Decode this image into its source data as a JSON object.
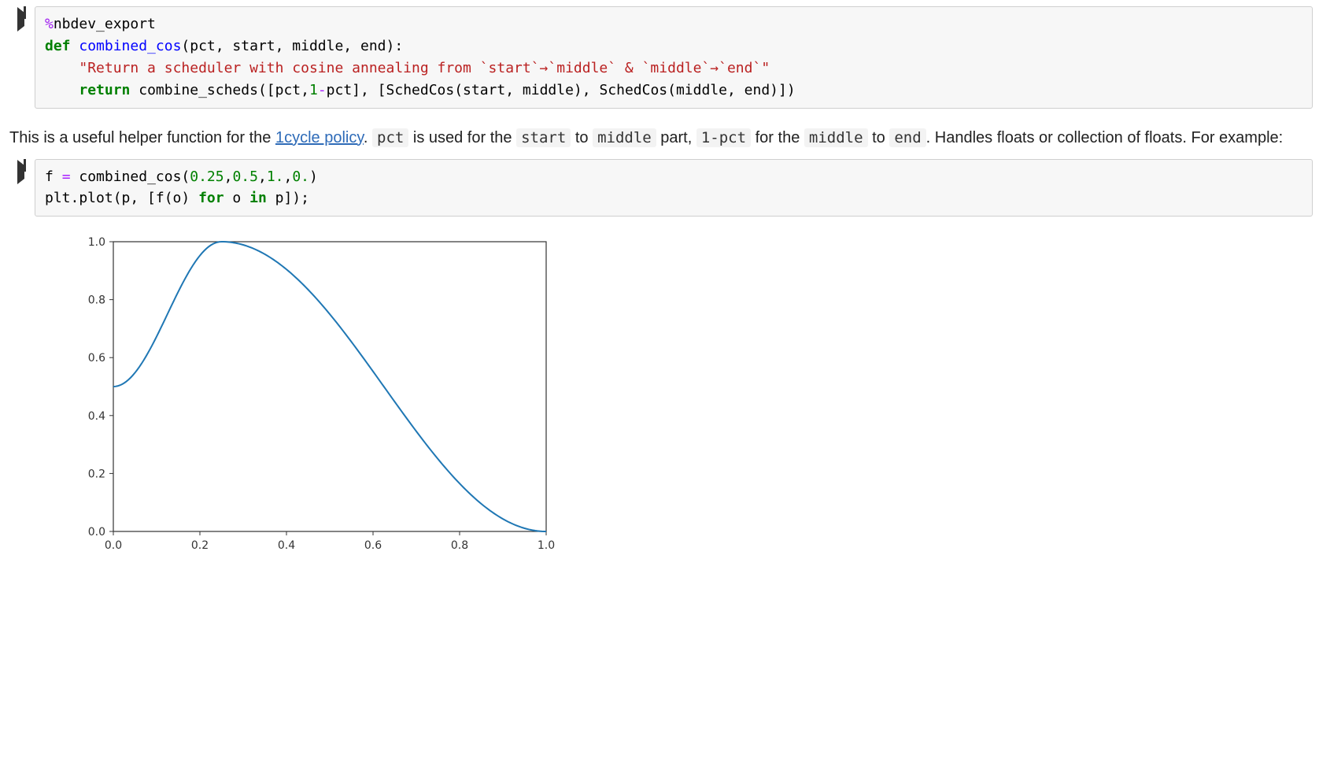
{
  "cell1": {
    "magic_pct": "%",
    "magic_name": "nbdev_export",
    "def_kw": "def",
    "fn_name": "combined_cos",
    "params": "(pct, start, middle, end):",
    "docstring": "\"Return a scheduler with cosine annealing from `start`→`middle` & `middle`→`end`\"",
    "return_kw": "return",
    "return_body_a": " combine_scheds([pct,",
    "one": "1",
    "minus": "-",
    "return_body_b": "pct], [SchedCos(start, middle), SchedCos(middle, end)])"
  },
  "md": {
    "pre_link": "This is a useful helper function for the ",
    "link_text": "1cycle policy",
    "post_link_1": ". ",
    "code_pct": "pct",
    "t2": " is used for the ",
    "code_start": "start",
    "t3": " to ",
    "code_middle": "middle",
    "t4": " part, ",
    "code_1mpct": "1-pct",
    "t5": " for the ",
    "code_middle2": "middle",
    "t6": " to ",
    "code_end": "end",
    "t7": ". Handles floats or collection of floats. For example:"
  },
  "cell2": {
    "l1a": "f ",
    "eq": "=",
    "l1b": " combined_cos(",
    "n1": "0.25",
    "c1": ",",
    "n2": "0.5",
    "c2": ",",
    "n3": "1.",
    "c3": ",",
    "n4": "0.",
    "l1c": ")",
    "l2a": "plt.plot(p, [f(o) ",
    "for": "for",
    "l2b": " o ",
    "in": "in",
    "l2c": " p]);"
  },
  "chart_data": {
    "type": "line",
    "x": [
      0,
      0.1,
      0.2,
      0.3,
      0.4,
      0.5,
      0.6,
      0.7,
      0.8,
      0.9,
      1.0
    ],
    "values": [
      0.5,
      0.7,
      0.97,
      0.99,
      0.93,
      0.79,
      0.6,
      0.38,
      0.19,
      0.06,
      0.0
    ],
    "xlim": [
      0.0,
      1.0
    ],
    "ylim": [
      0.0,
      1.0
    ],
    "yticks": [
      0.0,
      0.2,
      0.4,
      0.6,
      0.8,
      1.0
    ],
    "ytick_labels": [
      "0.0",
      "0.2",
      "0.4",
      "0.6",
      "0.8",
      "1.0"
    ],
    "xticks": [
      0.0,
      0.2,
      0.4,
      0.6,
      0.8,
      1.0
    ],
    "xtick_labels": [
      "0.0",
      "0.2",
      "0.4",
      "0.6",
      "0.8",
      "1.0"
    ],
    "line_color": "#1f77b4",
    "pct": 0.25,
    "start": 0.5,
    "middle": 1.0,
    "end": 0.0
  }
}
